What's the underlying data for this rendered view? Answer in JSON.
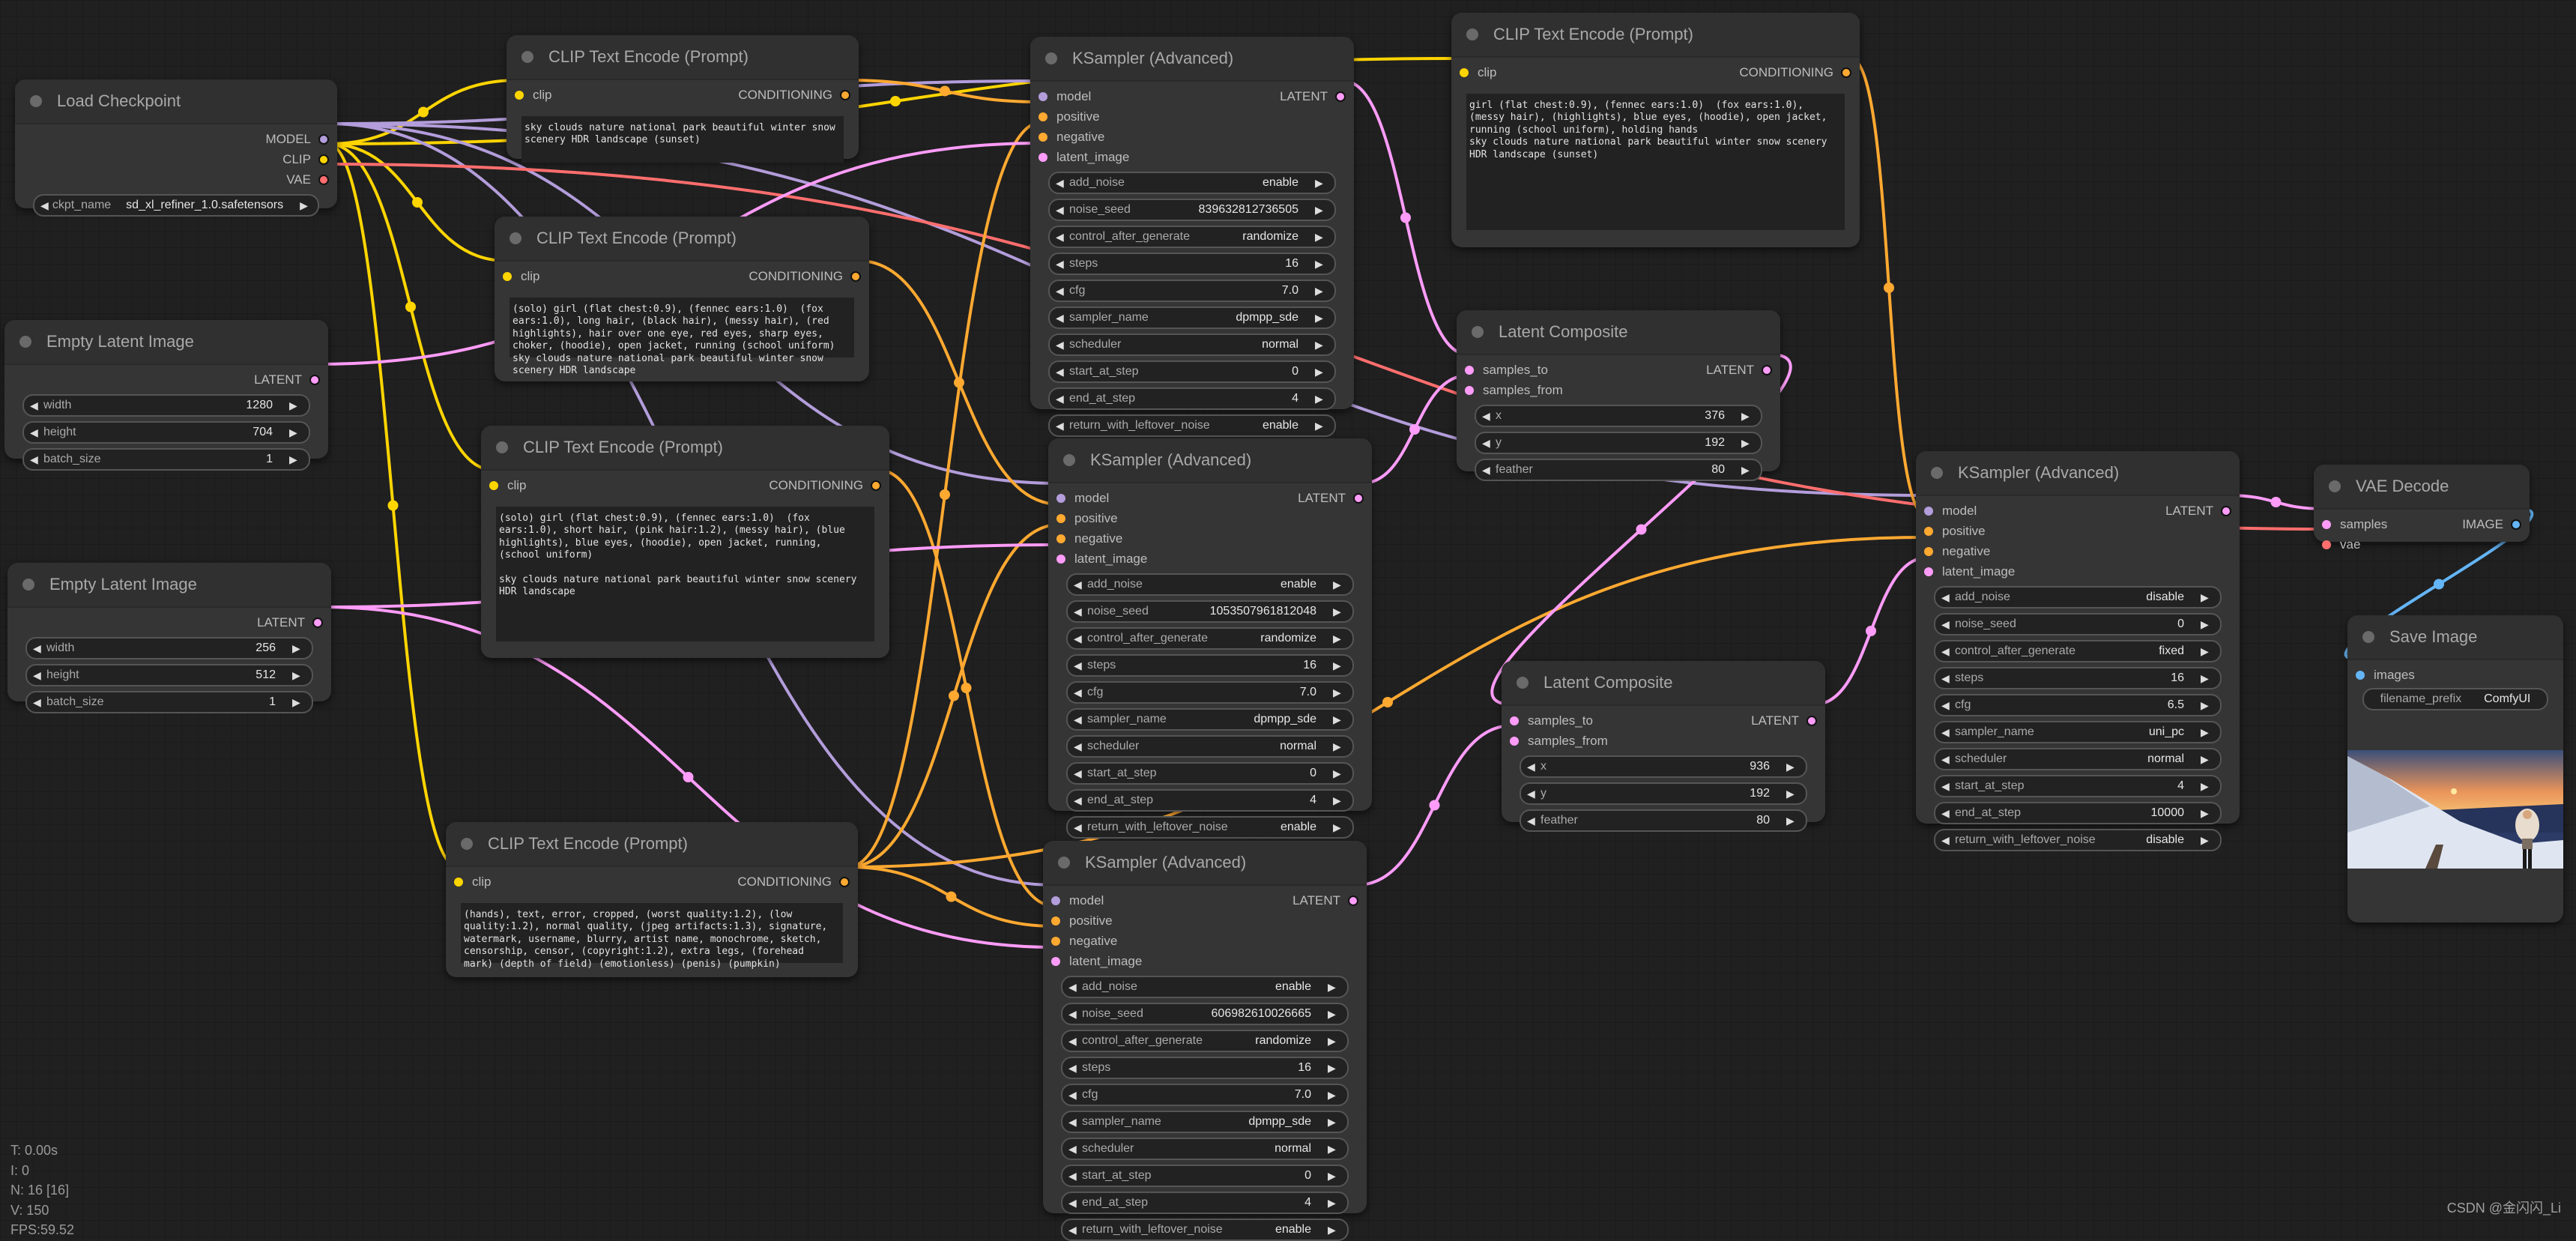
{
  "colors": {
    "model": "#b39ddb",
    "clip": "#ffd500",
    "vae": "#ff6e6e",
    "conditioning": "#ffa931",
    "latent": "#ff9cf9",
    "image": "#64b5f6"
  },
  "nodes": {
    "load_checkpoint": {
      "title": "Load Checkpoint",
      "outputs": [
        "MODEL",
        "CLIP",
        "VAE"
      ],
      "widgets": [
        {
          "label": "ckpt_name",
          "value": "sd_xl_refiner_1.0.safetensors"
        }
      ]
    },
    "clip_1": {
      "title": "CLIP Text Encode (Prompt)",
      "input": "clip",
      "output": "CONDITIONING",
      "text": "sky clouds nature national park beautiful winter snow\nscenery HDR landscape (sunset)"
    },
    "clip_2": {
      "title": "CLIP Text Encode (Prompt)",
      "input": "clip",
      "output": "CONDITIONING",
      "text": "(solo) girl (flat chest:0.9), (fennec ears:1.0)  (fox\nears:1.0), long hair, (black hair), (messy hair), (red\nhighlights), hair over one eye, red eyes, sharp eyes,\nchoker, (hoodie), open jacket, running (school uniform)\nsky clouds nature national park beautiful winter snow\nscenery HDR landscape"
    },
    "clip_3": {
      "title": "CLIP Text Encode (Prompt)",
      "input": "clip",
      "output": "CONDITIONING",
      "text": "(solo) girl (flat chest:0.9), (fennec ears:1.0)  (fox\nears:1.0), short hair, (pink hair:1.2), (messy hair), (blue\nhighlights), blue eyes, (hoodie), open jacket, running,\n(school uniform)\n\nsky clouds nature national park beautiful winter snow scenery\nHDR landscape"
    },
    "clip_4": {
      "title": "CLIP Text Encode (Prompt)",
      "input": "clip",
      "output": "CONDITIONING",
      "text": "(hands), text, error, cropped, (worst quality:1.2), (low\nquality:1.2), normal quality, (jpeg artifacts:1.3), signature,\nwatermark, username, blurry, artist name, monochrome, sketch,\ncensorship, censor, (copyright:1.2), extra legs, (forehead\nmark) (depth of field) (emotionless) (penis) (pumpkin)"
    },
    "clip_5": {
      "title": "CLIP Text Encode (Prompt)",
      "input": "clip",
      "output": "CONDITIONING",
      "text": "girl (flat chest:0.9), (fennec ears:1.0)  (fox ears:1.0),\n(messy hair), (highlights), blue eyes, (hoodie), open jacket,\nrunning (school uniform), holding hands\nsky clouds nature national park beautiful winter snow scenery\nHDR landscape (sunset)"
    },
    "empty_latent_1": {
      "title": "Empty Latent Image",
      "output": "LATENT",
      "widgets": [
        {
          "label": "width",
          "value": "1280"
        },
        {
          "label": "height",
          "value": "704"
        },
        {
          "label": "batch_size",
          "value": "1"
        }
      ]
    },
    "empty_latent_2": {
      "title": "Empty Latent Image",
      "output": "LATENT",
      "widgets": [
        {
          "label": "width",
          "value": "256"
        },
        {
          "label": "height",
          "value": "512"
        },
        {
          "label": "batch_size",
          "value": "1"
        }
      ]
    },
    "ksampler_1": {
      "title": "KSampler (Advanced)",
      "inputs": [
        "model",
        "positive",
        "negative",
        "latent_image"
      ],
      "output": "LATENT",
      "widgets": [
        {
          "label": "add_noise",
          "value": "enable"
        },
        {
          "label": "noise_seed",
          "value": "839632812736505"
        },
        {
          "label": "control_after_generate",
          "value": "randomize"
        },
        {
          "label": "steps",
          "value": "16"
        },
        {
          "label": "cfg",
          "value": "7.0"
        },
        {
          "label": "sampler_name",
          "value": "dpmpp_sde"
        },
        {
          "label": "scheduler",
          "value": "normal"
        },
        {
          "label": "start_at_step",
          "value": "0"
        },
        {
          "label": "end_at_step",
          "value": "4"
        },
        {
          "label": "return_with_leftover_noise",
          "value": "enable"
        }
      ]
    },
    "ksampler_2": {
      "title": "KSampler (Advanced)",
      "inputs": [
        "model",
        "positive",
        "negative",
        "latent_image"
      ],
      "output": "LATENT",
      "widgets": [
        {
          "label": "add_noise",
          "value": "enable"
        },
        {
          "label": "noise_seed",
          "value": "1053507961812048"
        },
        {
          "label": "control_after_generate",
          "value": "randomize"
        },
        {
          "label": "steps",
          "value": "16"
        },
        {
          "label": "cfg",
          "value": "7.0"
        },
        {
          "label": "sampler_name",
          "value": "dpmpp_sde"
        },
        {
          "label": "scheduler",
          "value": "normal"
        },
        {
          "label": "start_at_step",
          "value": "0"
        },
        {
          "label": "end_at_step",
          "value": "4"
        },
        {
          "label": "return_with_leftover_noise",
          "value": "enable"
        }
      ]
    },
    "ksampler_3": {
      "title": "KSampler (Advanced)",
      "inputs": [
        "model",
        "positive",
        "negative",
        "latent_image"
      ],
      "output": "LATENT",
      "widgets": [
        {
          "label": "add_noise",
          "value": "enable"
        },
        {
          "label": "noise_seed",
          "value": "606982610026665"
        },
        {
          "label": "control_after_generate",
          "value": "randomize"
        },
        {
          "label": "steps",
          "value": "16"
        },
        {
          "label": "cfg",
          "value": "7.0"
        },
        {
          "label": "sampler_name",
          "value": "dpmpp_sde"
        },
        {
          "label": "scheduler",
          "value": "normal"
        },
        {
          "label": "start_at_step",
          "value": "0"
        },
        {
          "label": "end_at_step",
          "value": "4"
        },
        {
          "label": "return_with_leftover_noise",
          "value": "enable"
        }
      ]
    },
    "ksampler_4": {
      "title": "KSampler (Advanced)",
      "inputs": [
        "model",
        "positive",
        "negative",
        "latent_image"
      ],
      "output": "LATENT",
      "widgets": [
        {
          "label": "add_noise",
          "value": "disable"
        },
        {
          "label": "noise_seed",
          "value": "0"
        },
        {
          "label": "control_after_generate",
          "value": "fixed"
        },
        {
          "label": "steps",
          "value": "16"
        },
        {
          "label": "cfg",
          "value": "6.5"
        },
        {
          "label": "sampler_name",
          "value": "uni_pc"
        },
        {
          "label": "scheduler",
          "value": "normal"
        },
        {
          "label": "start_at_step",
          "value": "4"
        },
        {
          "label": "end_at_step",
          "value": "10000"
        },
        {
          "label": "return_with_leftover_noise",
          "value": "disable"
        }
      ]
    },
    "latent_composite_1": {
      "title": "Latent Composite",
      "inputs": [
        "samples_to",
        "samples_from"
      ],
      "output": "LATENT",
      "widgets": [
        {
          "label": "x",
          "value": "376"
        },
        {
          "label": "y",
          "value": "192"
        },
        {
          "label": "feather",
          "value": "80"
        }
      ]
    },
    "latent_composite_2": {
      "title": "Latent Composite",
      "inputs": [
        "samples_to",
        "samples_from"
      ],
      "output": "LATENT",
      "widgets": [
        {
          "label": "x",
          "value": "936"
        },
        {
          "label": "y",
          "value": "192"
        },
        {
          "label": "feather",
          "value": "80"
        }
      ]
    },
    "vae_decode": {
      "title": "VAE Decode",
      "inputs": [
        "samples",
        "vae"
      ],
      "output": "IMAGE"
    },
    "save_image": {
      "title": "Save Image",
      "input": "images",
      "widgets": [
        {
          "label": "filename_prefix",
          "value": "ComfyUI"
        }
      ],
      "preview": "snowy mountain sunset landscape with girl in white hooded coat"
    }
  },
  "stats": {
    "time": "T: 0.00s",
    "iterations": "I: 0",
    "nodes": "N: 16 [16]",
    "vertices": "V: 150",
    "fps": "FPS:59.52"
  },
  "watermark": "CSDN @金闪闪_Li"
}
